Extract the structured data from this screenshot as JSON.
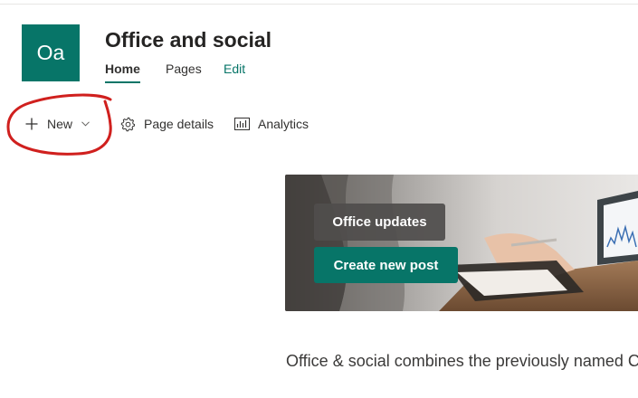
{
  "site": {
    "logo_text": "Oa",
    "logo_color": "#077568",
    "title": "Office and social"
  },
  "nav": {
    "items": [
      {
        "label": "Home",
        "active": true
      },
      {
        "label": "Pages"
      },
      {
        "label": "Edit"
      }
    ]
  },
  "commandbar": {
    "new_label": "New",
    "page_details_label": "Page details",
    "analytics_label": "Analytics",
    "icons": [
      "plus-icon",
      "chevron-down-icon",
      "gear-icon",
      "analytics-icon"
    ]
  },
  "hero": {
    "updates_button": "Office updates",
    "create_button": "Create new post",
    "accent": "#077568"
  },
  "description": {
    "text": "Office & social combines the previously named C"
  },
  "annotation": {
    "color": "#d0201e"
  }
}
